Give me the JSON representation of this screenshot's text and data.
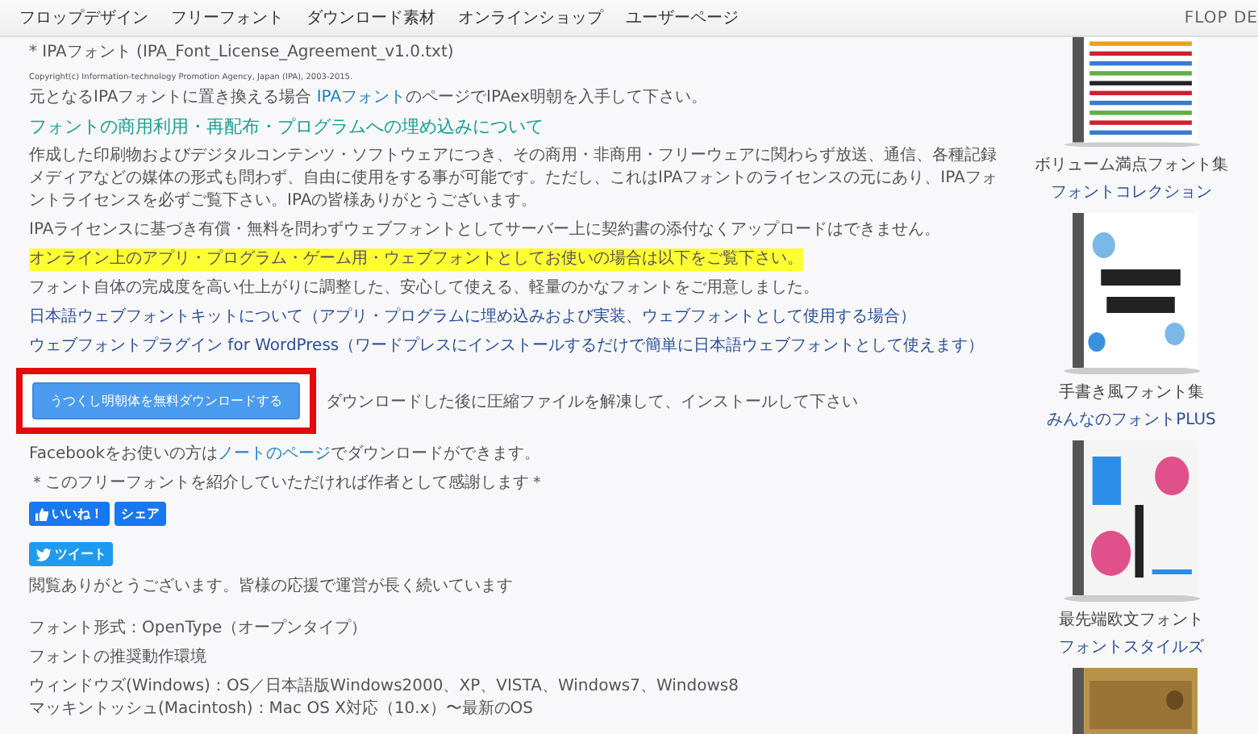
{
  "nav": {
    "items": [
      "フロップデザイン",
      "フリーフォント",
      "ダウンロード素材",
      "オンラインショップ",
      "ユーザーページ"
    ],
    "brand": "FLOP DE"
  },
  "content": [
    {
      "kind": "plain",
      "text": "* IPAフォント (IPA_Font_License_Agreement_v1.0.txt)"
    },
    {
      "kind": "small",
      "text": "Copyright(c) Information-technology Promotion Agency, Japan (IPA), 2003-2015."
    },
    {
      "kind": "plain",
      "parts": [
        {
          "text": "元となるIPAフォントに置き換える場合 ",
          "link": false
        },
        {
          "text": "IPAフォント",
          "link": true
        },
        {
          "text": "のページでIPAex明朝を入手して下さい。",
          "link": false
        }
      ]
    },
    {
      "kind": "heading",
      "text": "フォントの商用利用・再配布・プログラムへの埋め込みについて"
    },
    {
      "kind": "plain",
      "text": "作成した印刷物およびデジタルコンテンツ・ソフトウェアにつき、その商用・非商用・フリーウェアに関わらず放送、通信、各種記録メディアなどの媒体の形式も問わず、自由に使用をする事が可能です。ただし、これはIPAフォントのライセンスの元にあり、IPAフォントライセンスを必ずご覧下さい。IPAの皆様ありがとうございます。"
    },
    {
      "kind": "plain",
      "text": "IPAライセンスに基づき有償・無料を問わずウェブフォントとしてサーバー上に契約書の添付なくアップロードはできません。"
    },
    {
      "kind": "marker",
      "text": "オンライン上のアプリ・プログラム・ゲーム用・ウェブフォントとしてお使いの場合は以下をご覧下さい。"
    },
    {
      "kind": "plain",
      "text": "フォント自体の完成度を高い仕上がりに調整した、安心して使える、軽量のかなフォントをご用意しました。"
    },
    {
      "kind": "link",
      "text": "日本語ウェブフォントキットについて（アプリ・プログラムに埋め込みおよび実装、ウェブフォントとして使用する場合）"
    },
    {
      "kind": "link",
      "text": "ウェブフォントプラグイン for WordPress（ワードプレスにインストールするだけで簡単に日本語ウェブフォントとして使えます）"
    },
    {
      "kind": "download",
      "button": "うつくし明朝体を無料ダウンロードする",
      "note": "ダウンロードした後に圧縮ファイルを解凍して、インストールして下さい",
      "highlighted": true
    },
    {
      "kind": "plain",
      "parts": [
        {
          "text": "Facebookをお使いの方は",
          "link": false
        },
        {
          "text": "ノートのページ",
          "link": true
        },
        {
          "text": "でダウンロードができます。",
          "link": false
        }
      ]
    },
    {
      "kind": "plain",
      "text": "＊このフリーフォントを紹介していただければ作者として感謝します＊"
    },
    {
      "kind": "social",
      "buttons": [
        {
          "kind": "like",
          "label": "いいね！"
        },
        {
          "kind": "share",
          "label": "シェア"
        }
      ]
    },
    {
      "kind": "social",
      "buttons": [
        {
          "kind": "tweet",
          "label": "ツイート"
        }
      ]
    },
    {
      "kind": "plain",
      "text": "閲覧ありがとうございます。皆様の応援で運営が長く続いています"
    },
    {
      "kind": "spacer"
    },
    {
      "kind": "plain",
      "text": "フォント形式：OpenType（オープンタイプ）"
    },
    {
      "kind": "plain",
      "text": "フォントの推奨動作環境"
    },
    {
      "kind": "line",
      "text": "ウィンドウズ(Windows)：OS／日本語版Windows2000、XP、VISTA、Windows7、Windows8"
    },
    {
      "kind": "line",
      "text": "マッキントッシュ(Macintosh)：Mac OS X対応（10.x）〜最新のOS"
    }
  ],
  "sidebar": {
    "products": [
      {
        "kind": "collection",
        "caption": "ボリューム満点フォント集",
        "link": "フォントコレクション"
      },
      {
        "kind": "hand",
        "caption": "手書き風フォント集",
        "link": "みんなのフォントPLUS"
      },
      {
        "kind": "style",
        "caption": "最先端欧文フォント",
        "link": "フォントスタイルズ"
      },
      {
        "kind": "story"
      }
    ]
  }
}
